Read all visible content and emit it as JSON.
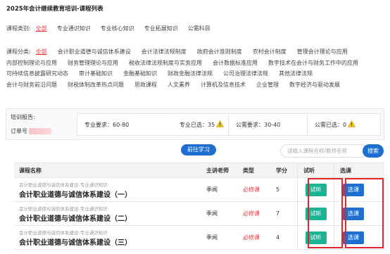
{
  "page": {
    "title": "2025年会计继续教育培训-课程列表"
  },
  "course_category": {
    "label": "课程类别:",
    "options": [
      "全部",
      "专业通识知识",
      "专业核心知识",
      "专业拓展知识",
      "公需科目"
    ],
    "active_index": 0
  },
  "course_classification": {
    "label": "课程分类:",
    "lines": [
      [
        "全部",
        "会计职业道德与诚信体系建设",
        "会计法律法规制度",
        "政府会计准则制度",
        "农村会计制度",
        "管理会计理论与应用"
      ],
      [
        "内部控制理论与应用",
        "财务管理理论与应用",
        "税收法律法规制度与实务应用",
        "会计数据标准应用",
        "数字技术在会计与财务工作中的应用"
      ],
      [
        "可持续信息披露研究动态",
        "审计基础知识",
        "金融基础知识",
        "财政金融法律法规",
        "公司治理法律法规",
        "其他法律法规"
      ],
      [
        "会计与财务前沿问题",
        "财税体制改革热点问题",
        "思政课程",
        "人文素养",
        "计算机及信息技术",
        "企业管理",
        "数字经济与驱动发展"
      ]
    ],
    "active": "全部"
  },
  "report": {
    "title": "培训报告:",
    "order_label": "订单号",
    "professional_requirement": "专业要求：60-80",
    "professional_selected": "专业已选：35",
    "public_requirement": "公需要求：30-40",
    "public_selected": "公需已选：0"
  },
  "actions": {
    "go_learn": "前往学习",
    "search_placeholder": "请输入课程名称/教师名称",
    "search_button": "搜索"
  },
  "table": {
    "headers": [
      "课程名称",
      "主讲老师",
      "类型",
      "学分",
      "试听",
      "选课"
    ],
    "rows": [
      {
        "subtitle": "会计职业道德与诚信体系建设-专业通识知识",
        "title": "会计职业道德与诚信体系建设（一）",
        "teacher": "季闻",
        "type": "必修课",
        "credit": "5",
        "trial": "试听",
        "select": "选课"
      },
      {
        "subtitle": "会计职业道德与诚信体系建设-专业通识知识",
        "title": "会计职业道德与诚信体系建设（二）",
        "teacher": "季闻",
        "type": "必修课",
        "credit": "7",
        "trial": "试听",
        "select": "选课"
      },
      {
        "subtitle": "会计职业道德与诚信体系建设-专业通识知识",
        "title": "会计职业道德与诚信体系建设（三）",
        "teacher": "季闻",
        "type": "必修课",
        "credit": "4",
        "trial": "试听",
        "select": "选课"
      }
    ]
  },
  "colors": {
    "accent_red": "#e0393e",
    "primary_blue": "#1f6fd0",
    "trial_green": "#1ab394",
    "warning_yellow": "#f5c518"
  }
}
